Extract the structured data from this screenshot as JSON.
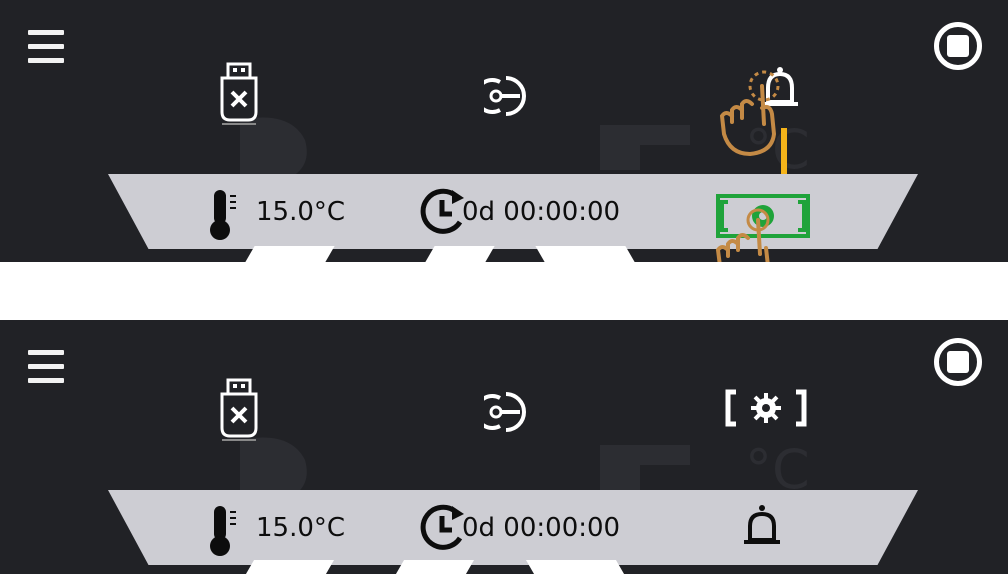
{
  "panels": [
    {
      "temperature": "15.0°C",
      "timer": "0d 00:00:00",
      "top_icons": [
        "usb-drive-icon",
        "key-login-icon",
        "bell-icon"
      ],
      "bar_right_icon": "settings-screen-icon"
    },
    {
      "temperature": "15.0°C",
      "timer": "0d 00:00:00",
      "top_icons": [
        "usb-drive-icon",
        "key-login-icon",
        "settings-screen-icon"
      ],
      "bar_right_icon": "bell-icon"
    }
  ],
  "colors": {
    "panel_bg": "#212226",
    "bar_bg": "#cdcdd3",
    "highlight": "#1fa33a",
    "arrow": "#f5b41a",
    "hand": "#c48a45"
  }
}
